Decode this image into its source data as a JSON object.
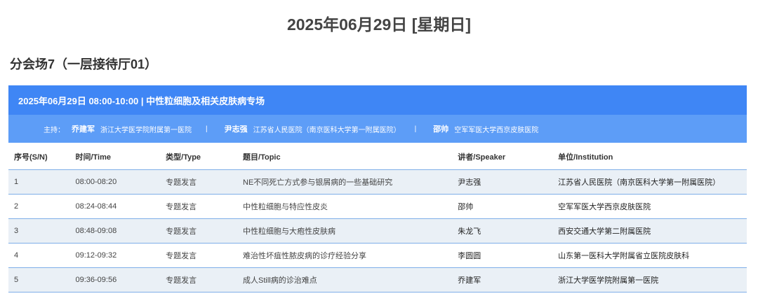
{
  "page": {
    "date_title": "2025年06月29日 [星期日]",
    "venue": "分会场7（一层接待厅01）"
  },
  "session": {
    "title": "2025年06月29日 08:00-10:00 | 中性粒细胞及相关皮肤病专场",
    "host_label": "主持：",
    "hosts": [
      {
        "name": "乔建军",
        "affiliation": "浙江大学医学院附属第一医院"
      },
      {
        "name": "尹志强",
        "affiliation": "江苏省人民医院（南京医科大学第一附属医院）"
      },
      {
        "name": "邵帅",
        "affiliation": "空军军医大学西京皮肤医院"
      }
    ],
    "separator": "|"
  },
  "table": {
    "headers": [
      "序号(S/N)",
      "时间/Time",
      "类型/Type",
      "题目/Topic",
      "讲者/Speaker",
      "单位/Institution"
    ],
    "rows": [
      {
        "sn": "1",
        "time": "08:00-08:20",
        "type": "专题发言",
        "topic": "NE不同死亡方式参与银屑病的一些基础研究",
        "speaker": "尹志强",
        "institution": "江苏省人民医院（南京医科大学第一附属医院）"
      },
      {
        "sn": "2",
        "time": "08:24-08:44",
        "type": "专题发言",
        "topic": "中性粒细胞与特应性皮炎",
        "speaker": "邵帅",
        "institution": "空军军医大学西京皮肤医院"
      },
      {
        "sn": "3",
        "time": "08:48-09:08",
        "type": "专题发言",
        "topic": "中性粒细胞与大疱性皮肤病",
        "speaker": "朱龙飞",
        "institution": "西安交通大学第二附属医院"
      },
      {
        "sn": "4",
        "time": "09:12-09:32",
        "type": "专题发言",
        "topic": "难治性坏疽性脓皮病的诊疗经验分享",
        "speaker": "李圆圆",
        "institution": "山东第一医科大学附属省立医院皮肤科"
      },
      {
        "sn": "5",
        "time": "09:36-09:56",
        "type": "专题发言",
        "topic": "成人Still病的诊治难点",
        "speaker": "乔建军",
        "institution": "浙江大学医学院附属第一医院"
      }
    ]
  },
  "colors": {
    "header_bg": "#3f86f5",
    "hosts_bg": "#5d9df7",
    "row_alt_bg": "#eaf0f6",
    "row_border": "#7eaee8"
  }
}
